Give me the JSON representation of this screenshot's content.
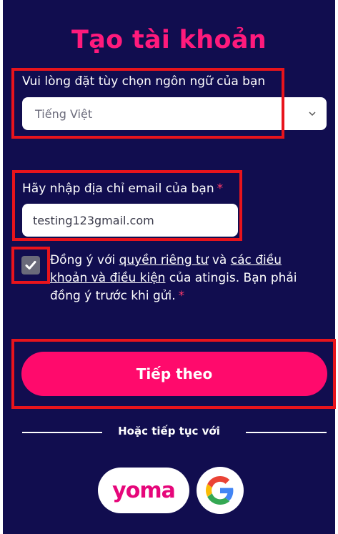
{
  "title": "Tạo tài khoản",
  "language": {
    "label": "Vui lòng đặt tùy chọn ngôn ngữ của bạn",
    "selected": "Tiếng Việt"
  },
  "email": {
    "label": "Hãy nhập địa chỉ email của bạn",
    "required_mark": "*",
    "value": "testing123gmail.com"
  },
  "consent": {
    "checked": true,
    "text_before": "Đồng ý với ",
    "privacy_link": "quyền riêng tư",
    "and": " và ",
    "terms_link": "các điều khoản và điều kiện",
    "text_after": " của atingis. Bạn phải đồng ý trước khi gửi.",
    "required_mark": "*"
  },
  "submit_label": "Tiếp theo",
  "alt_login": {
    "label": "Hoặc tiếp tục với",
    "yoma_text": "yoma",
    "providers": [
      "yoma-icon",
      "google-icon"
    ]
  },
  "colors": {
    "background": "#110d4f",
    "accent": "#ff0a6c",
    "title": "#ff1a7c",
    "highlight": "#e8141c"
  }
}
